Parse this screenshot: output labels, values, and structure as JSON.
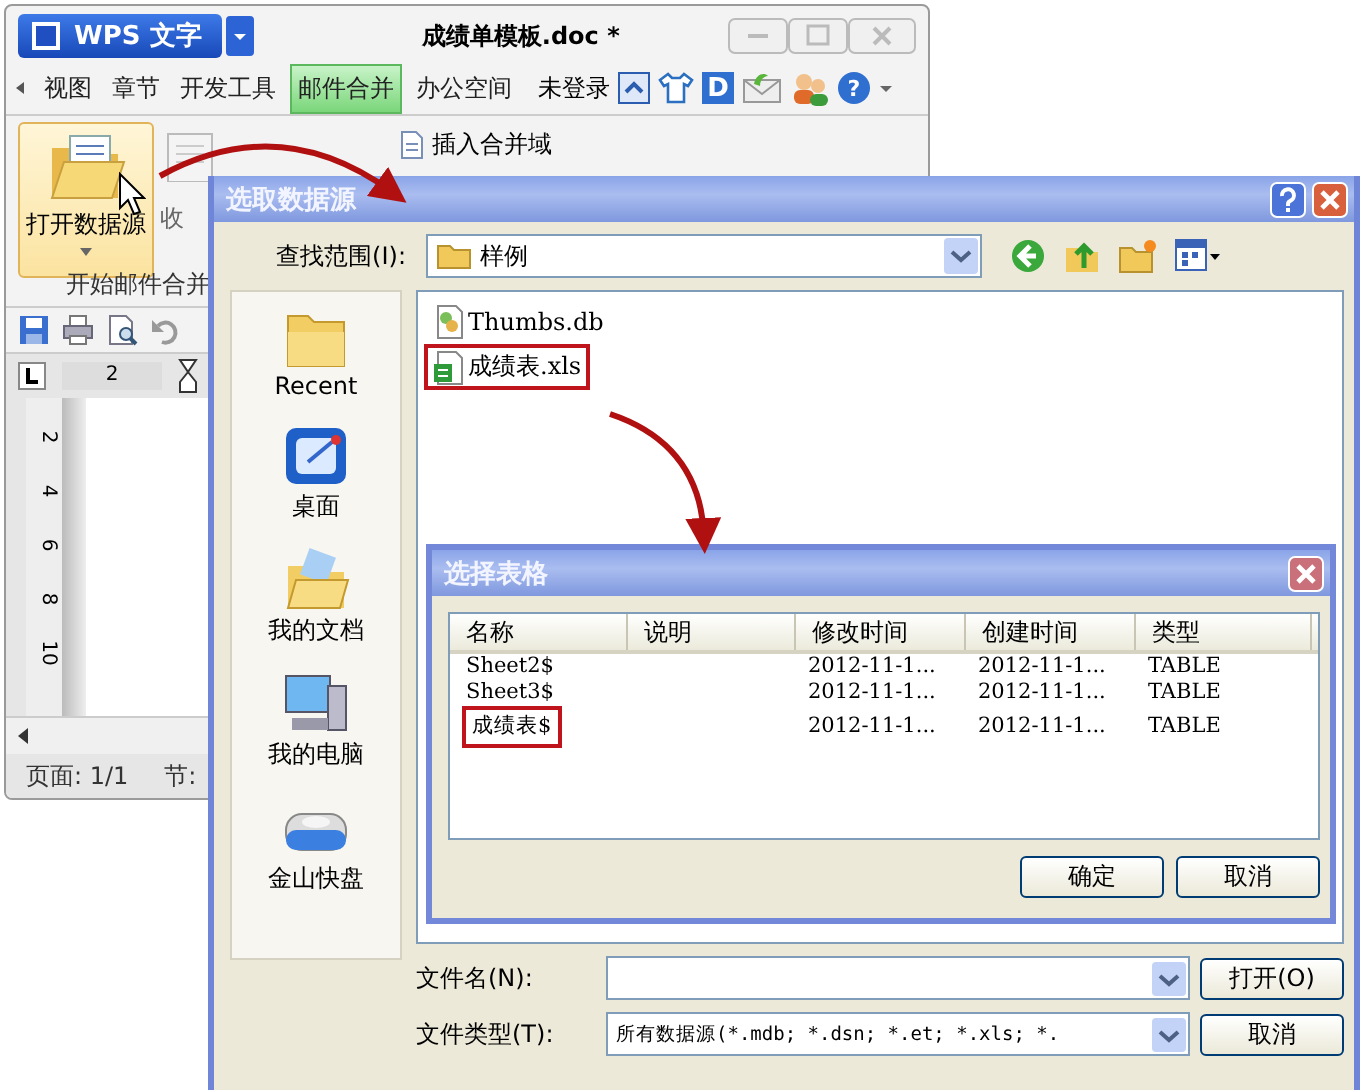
{
  "app_window": {
    "logo": "WPS 文字",
    "title": "成绩单模板.doc *",
    "tabs": [
      {
        "label": "视图",
        "selected": false
      },
      {
        "label": "章节",
        "selected": false
      },
      {
        "label": "开发工具",
        "selected": false
      },
      {
        "label": "邮件合并",
        "selected": true
      },
      {
        "label": "办公空间",
        "selected": false
      }
    ],
    "login": "未登录",
    "badge": "D",
    "help": "?",
    "ribbon": {
      "open_data_source": "打开数据源",
      "recipients": "收",
      "insert_merge_field": "插入合并域",
      "group_label": "开始邮件合并"
    },
    "ruler_number": "2",
    "vertical_ruler": [
      "2",
      "4",
      "6",
      "8",
      "10"
    ],
    "status": "页面: 1/1",
    "status_section": "节:"
  },
  "data_source_dialog": {
    "title": "选取数据源",
    "look_in_label": "查找范围(I):",
    "look_in_value": "样例",
    "places": [
      {
        "label": "Recent",
        "kind": "recent"
      },
      {
        "label": "桌面",
        "kind": "desktop"
      },
      {
        "label": "我的文档",
        "kind": "documents"
      },
      {
        "label": "我的电脑",
        "kind": "computer"
      },
      {
        "label": "金山快盘",
        "kind": "drive"
      }
    ],
    "files": [
      {
        "name": "Thumbs.db",
        "kind": "db",
        "highlighted": false
      },
      {
        "name": "成绩表.xls",
        "kind": "xls",
        "highlighted": true
      }
    ],
    "file_name_label": "文件名(N):",
    "file_type_label": "文件类型(T):",
    "file_type_value": "所有数据源(*.mdb; *.dsn; *.et; *.xls; *.",
    "open_button": "打开(O)",
    "cancel_button": "取消"
  },
  "table_dialog": {
    "title": "选择表格",
    "columns": [
      "名称",
      "说明",
      "修改时间",
      "创建时间",
      "类型"
    ],
    "rows": [
      {
        "cells": [
          "Sheet2$",
          "",
          "2012-11-1...",
          "2012-11-1...",
          "TABLE"
        ],
        "highlighted": false
      },
      {
        "cells": [
          "Sheet3$",
          "",
          "2012-11-1...",
          "2012-11-1...",
          "TABLE"
        ],
        "highlighted": false
      },
      {
        "cells": [
          "成绩表$",
          "",
          "2012-11-1...",
          "2012-11-1...",
          "TABLE"
        ],
        "highlighted": true
      }
    ],
    "ok_button": "确定",
    "cancel_button": "取消"
  }
}
